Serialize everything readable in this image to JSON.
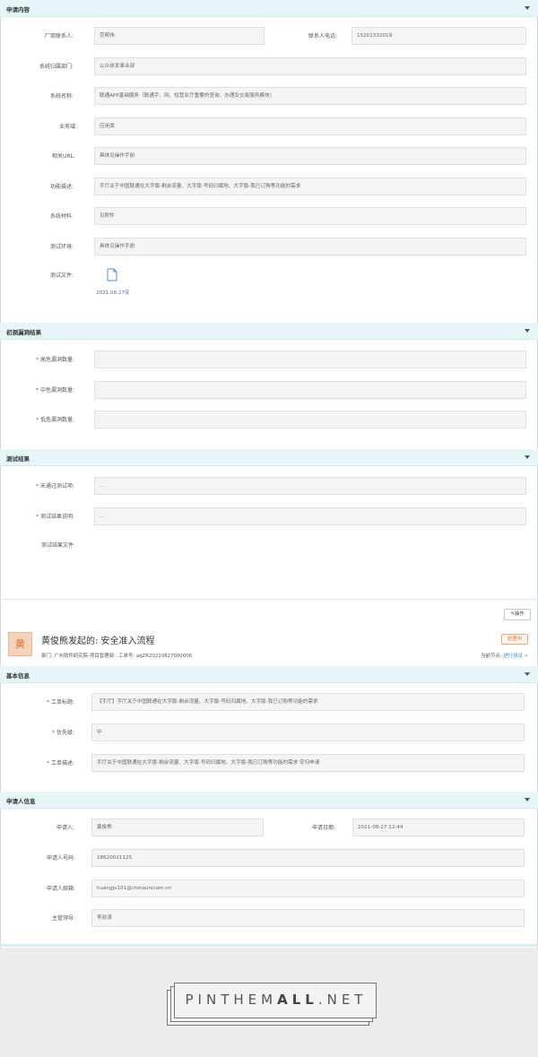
{
  "sections": {
    "apply_content": "申请内容",
    "initial_scan": "初测漏洞结果",
    "test_result": "测试结果",
    "basic_info": "基本信息",
    "applicant_info": "申请人信息"
  },
  "apply": {
    "vendor_contact_label": "厂商联系人:",
    "vendor_contact": "范明伟",
    "contact_phone_label": "联系人电话:",
    "contact_phone": "15201332019",
    "dept_label": "系统归属部门:",
    "dept": "公众研发事业部",
    "system_name_label": "系统名称:",
    "system_name": "联通APP基础服务（联通手、网、短营业厅重要的查询、办理及交易服务模块）",
    "domain_label": "业务域:",
    "domain": "应用类",
    "url_label": "相关URL:",
    "url": "具体见操作手册",
    "desc_label": "功能描述:",
    "desc": "手厅关于中国联通在大字版-剩余流量、大字版-号码归属地、大字版-我已订购等功能的需求",
    "material_label": "系统材料:",
    "material": "见附件",
    "env_label": "测试环境:",
    "env": "具体见操作手册",
    "file_label": "测试文件:",
    "file_name": "2021.08.27安"
  },
  "scan": {
    "high_label": "高危漏洞数量:",
    "high": "",
    "mid_label": "中危漏洞数量:",
    "mid": "",
    "low_label": "低危漏洞数量:",
    "low": ""
  },
  "result": {
    "failed_label": "未通过测试项:",
    "failed": "...",
    "explain_label": "测试结果说明:",
    "explain": "...",
    "file_label": "测试结果文件:",
    "op_button": "操作"
  },
  "flow": {
    "avatar": "黄",
    "title": "黄俊熊发起的: 安全准入流程",
    "dept_label": "部门:",
    "dept": "广州软件研究院-项目管理部",
    "ticket_label": "工单号:",
    "ticket": "aqZR20210827000006",
    "status": "处理中",
    "node_label": "当前节点:",
    "node": "进行测试 >"
  },
  "basic": {
    "title_label": "工单标题:",
    "title": "【手厅】手厅关于中国联通在大字版-剩余流量、大字版-号码归属地、大字版-我已订购等功能的需求",
    "priority_label": "优先级:",
    "priority": "中",
    "desc_label": "工单描述:",
    "desc": "手厅关于中国联通在大字版-剩余流量、大字版-号码归属地、大字版-我已订购等功能的需求 安归申请"
  },
  "applicant": {
    "name_label": "申请人:",
    "name": "黄俊熊",
    "date_label": "申请日期:",
    "date": "2021-08-27 12:44",
    "phone_label": "申请人号码:",
    "phone": "18620021125",
    "email_label": "申请人邮箱:",
    "email": "huangjx101@chinaunicom.cn",
    "leader_label": "主管领导:",
    "leader": "李劲涛"
  },
  "watermark": {
    "logo_part1": "PIN",
    "logo_part2": "THEM",
    "logo_part3": "ALL",
    "logo_part4": ".NET"
  },
  "colors": {
    "section_bg": "#e6f5f7",
    "field_bg": "#f3f4f5",
    "required": "#e53935",
    "status": "#e07a32",
    "link": "#2c8fd8"
  }
}
